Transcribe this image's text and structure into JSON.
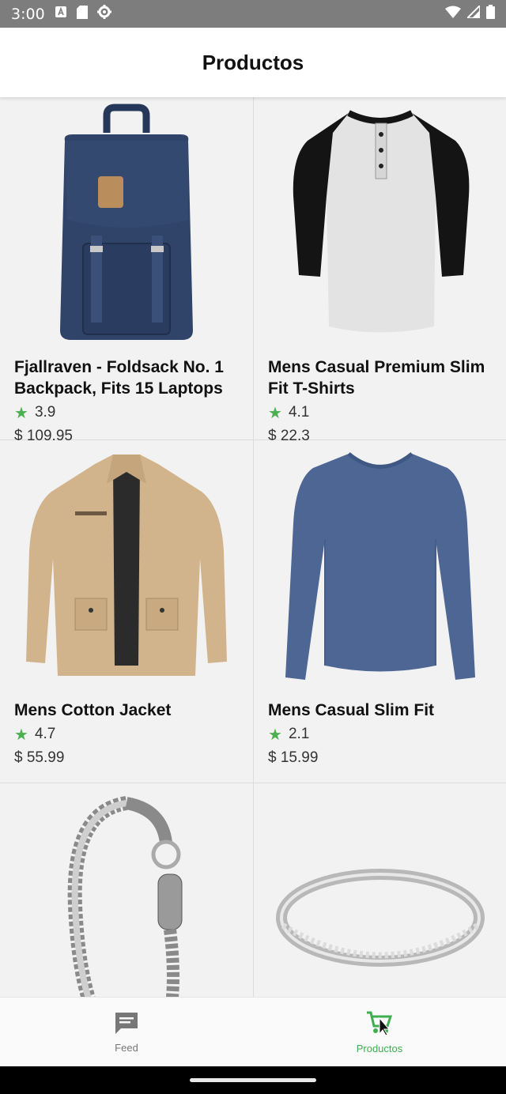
{
  "status_bar": {
    "time": "3:00",
    "left_icons": [
      "a-notification-icon",
      "sd-card-icon",
      "settings-gear-icon"
    ],
    "right_icons": [
      "wifi-icon",
      "signal-icon",
      "battery-icon"
    ]
  },
  "app_bar": {
    "title": "Productos"
  },
  "products": [
    {
      "title": "Fjallraven - Foldsack No. 1 Backpack, Fits 15 Laptops",
      "rating": "3.9",
      "price": "$ 109.95",
      "image_icon": "backpack-image"
    },
    {
      "title": "Mens Casual Premium Slim Fit T-Shirts",
      "rating": "4.1",
      "price": "$ 22.3",
      "image_icon": "henley-shirt-image"
    },
    {
      "title": "Mens Cotton Jacket",
      "rating": "4.7",
      "price": "$ 55.99",
      "image_icon": "cotton-jacket-image"
    },
    {
      "title": "Mens Casual Slim Fit",
      "rating": "2.1",
      "price": "$ 15.99",
      "image_icon": "long-sleeve-shirt-image"
    },
    {
      "title": "",
      "rating": "",
      "price": "",
      "image_icon": "chain-bracelet-image"
    },
    {
      "title": "",
      "rating": "",
      "price": "",
      "image_icon": "silver-ring-image"
    }
  ],
  "bottom_nav": {
    "items": [
      {
        "label": "Feed",
        "icon": "chat-bubble-icon",
        "active": false
      },
      {
        "label": "Productos",
        "icon": "cart-icon",
        "active": true
      }
    ]
  },
  "colors": {
    "accent": "#3fae50",
    "status_bar": "#7d7d7d",
    "star": "#4caf50"
  }
}
